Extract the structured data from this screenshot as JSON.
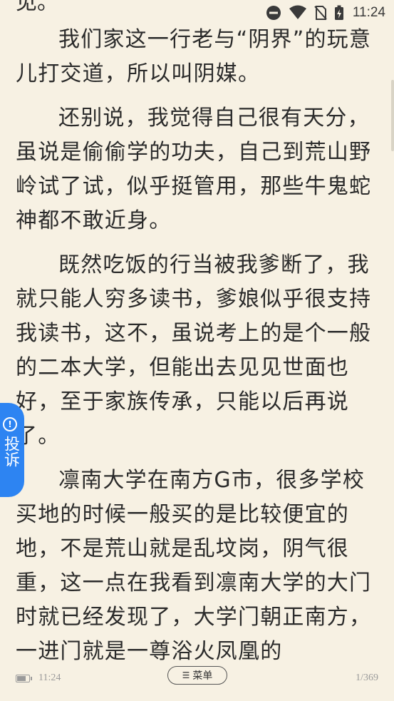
{
  "status_bar": {
    "cut_text": "见。",
    "time": "11:24"
  },
  "paragraphs": [
    "我们家这一行老与“阴界”的玩意儿打交道，所以叫阴媒。",
    "还别说，我觉得自己很有天分，虽说是偷偷学的功夫，自己到荒山野岭试了试，似乎挺管用，那些牛鬼蛇神都不敢近身。",
    "既然吃饭的行当被我爹断了，我就只能人穷多读书，爹娘似乎很支持我读书，这不，虽说考上的是个一般的二本大学，但能出去见见世面也好，至于家族传承，只能以后再说了。",
    "凛南大学在南方G市，很多学校买地的时候一般买的是比较便宜的地，不是荒山就是乱坟岗，阴气很重，这一点在我看到凛南大学的大门时就已经发现了，大学门朝正南方，一进门就是一尊浴火凤凰的"
  ],
  "complaint_tab": {
    "label": "投诉",
    "icon": "exclamation-circle-icon"
  },
  "footer": {
    "time": "11:24",
    "menu_label": "菜单",
    "page": "1/369"
  },
  "colors": {
    "background": "#f7f1e3",
    "text": "#2b2b2b",
    "accent": "#2d84f2",
    "muted": "#9a9a9a"
  }
}
